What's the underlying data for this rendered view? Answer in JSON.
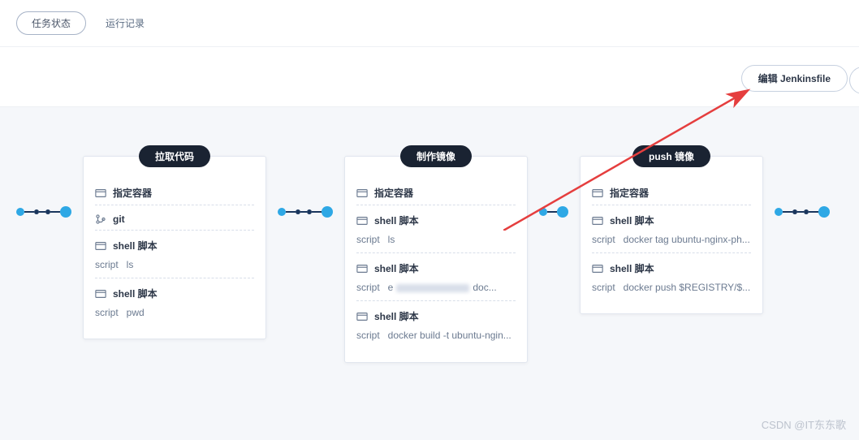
{
  "tabs": {
    "status": "任务状态",
    "runlog": "运行记录"
  },
  "toolbar": {
    "edit_jenkinsfile": "编辑 Jenkinsfile"
  },
  "stages": [
    {
      "title": "拉取代码",
      "container_label": "指定容器",
      "steps": [
        {
          "type": "git",
          "title": "git"
        },
        {
          "type": "shell",
          "title": "shell 脚本",
          "script_key": "script",
          "script_val": "ls"
        },
        {
          "type": "shell",
          "title": "shell 脚本",
          "script_key": "script",
          "script_val": "pwd"
        }
      ]
    },
    {
      "title": "制作镜像",
      "container_label": "指定容器",
      "steps": [
        {
          "type": "shell",
          "title": "shell 脚本",
          "script_key": "script",
          "script_val": "ls"
        },
        {
          "type": "shell",
          "title": "shell 脚本",
          "script_key": "script",
          "script_prefix": "e",
          "script_suffix": "doc...",
          "blurred": true
        },
        {
          "type": "shell",
          "title": "shell 脚本",
          "script_key": "script",
          "script_val": "docker build -t ubuntu-ngin..."
        }
      ]
    },
    {
      "title": "push 镜像",
      "container_label": "指定容器",
      "steps": [
        {
          "type": "shell",
          "title": "shell 脚本",
          "script_key": "script",
          "script_val": "docker tag ubuntu-nginx-ph..."
        },
        {
          "type": "shell",
          "title": "shell 脚本",
          "script_key": "script",
          "script_val": "docker push $REGISTRY/$..."
        }
      ]
    }
  ],
  "watermark": "CSDN @IT东东歌"
}
